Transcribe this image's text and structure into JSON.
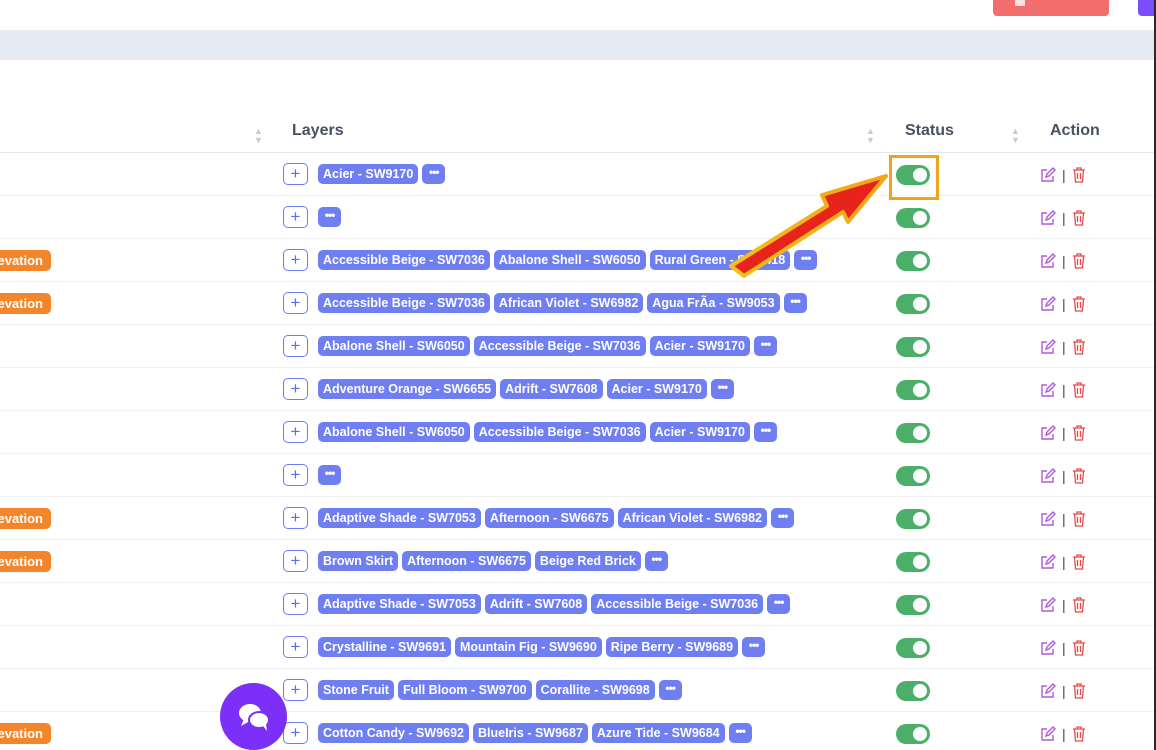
{
  "table": {
    "columns": {
      "layers": "Layers",
      "status": "Status",
      "action": "Action"
    },
    "more_label": "•••",
    "add_label": "+",
    "rows": [
      {
        "badge": "",
        "layers": [
          "Acier - SW9170"
        ],
        "status": "on"
      },
      {
        "badge": "",
        "layers": [],
        "status": "on"
      },
      {
        "badge": "evation",
        "layers": [
          "Accessible Beige - SW7036",
          "Abalone Shell - SW6050",
          "Rural Green - SW6418"
        ],
        "status": "on"
      },
      {
        "badge": "evation",
        "layers": [
          "Accessible Beige - SW7036",
          "African Violet - SW6982",
          "Agua FrÃa - SW9053"
        ],
        "status": "on"
      },
      {
        "badge": "",
        "layers": [
          "Abalone Shell - SW6050",
          "Accessible Beige - SW7036",
          "Acier - SW9170"
        ],
        "status": "on"
      },
      {
        "badge": "",
        "layers": [
          "Adventure Orange - SW6655",
          "Adrift - SW7608",
          "Acier - SW9170"
        ],
        "status": "on"
      },
      {
        "badge": "",
        "layers": [
          "Abalone Shell - SW6050",
          "Accessible Beige - SW7036",
          "Acier - SW9170"
        ],
        "status": "on"
      },
      {
        "badge": "",
        "layers": [],
        "status": "on"
      },
      {
        "badge": "evation",
        "layers": [
          "Adaptive Shade - SW7053",
          "Afternoon - SW6675",
          "African Violet - SW6982"
        ],
        "status": "on"
      },
      {
        "badge": "evation",
        "layers": [
          "Brown Skirt",
          "Afternoon - SW6675",
          "Beige Red Brick"
        ],
        "status": "on"
      },
      {
        "badge": "",
        "layers": [
          "Adaptive Shade - SW7053",
          "Adrift - SW7608",
          "Accessible Beige - SW7036"
        ],
        "status": "on"
      },
      {
        "badge": "",
        "layers": [
          "Crystalline - SW9691",
          "Mountain Fig - SW9690",
          "Ripe Berry - SW9689"
        ],
        "status": "on"
      },
      {
        "badge": "",
        "layers": [
          "Stone Fruit",
          "Full Bloom - SW9700",
          "Corallite - SW9698"
        ],
        "status": "on"
      },
      {
        "badge": "evation",
        "layers": [
          "Cotton Candy - SW9692",
          "BlueIris - SW9687",
          "Azure Tide - SW9684"
        ],
        "status": "on"
      }
    ]
  },
  "colors": {
    "tag": "#6f7ff2",
    "toggle_on": "#4caf69",
    "badge": "#f3862b",
    "edit_icon": "#b05ad6",
    "delete_icon": "#e84848",
    "highlight": "#f2a31b",
    "arrow": "#e8231a",
    "chat": "#7b2ff7"
  },
  "icons": {
    "edit": "edit-icon",
    "delete": "trash-icon",
    "chat": "chat-icon",
    "sort": "sort-icon"
  }
}
